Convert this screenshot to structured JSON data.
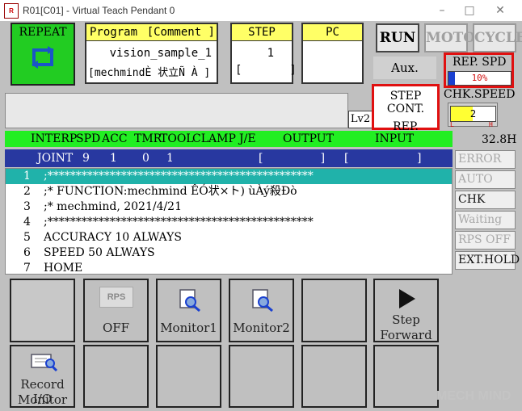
{
  "window": {
    "title": "R01[C01] - Virtual Teach Pendant 0",
    "icon": "robot-app-icon"
  },
  "mode_button": {
    "label": "REPEAT",
    "icon": "cycle-arrows-icon",
    "color": "#22cc22"
  },
  "program_panel": {
    "header_program": "Program",
    "header_comment": "[Comment ]",
    "program_name": "vision_sample_1",
    "comment_value": "[mechmindÈ 状立Ñ À ]"
  },
  "step_panel": {
    "header": "STEP",
    "value": "1",
    "bracket": "[       ]"
  },
  "pc_panel": {
    "header": "PC"
  },
  "mode_buttons": {
    "run": "RUN",
    "motor": "MOTOR",
    "cycle": "CYCLE"
  },
  "aux_label": "Aux.",
  "rep_spd": {
    "label": "REP. SPD",
    "value": "10%",
    "fill_percent": 10
  },
  "step_cont": {
    "line1": "STEP CONT.",
    "line2": "REP. ONCE"
  },
  "chk_speed": {
    "label": "CHK.SPEED",
    "value": "2",
    "l_label": "L",
    "h_label": "H"
  },
  "level_label": "Lv2",
  "status_header": {
    "interp": "INTERP",
    "spd": "SPD",
    "acc": "ACC",
    "tmr": "TMR",
    "tool": "TOOL",
    "clamp": "CLAMP",
    "je": "J/E",
    "output": "OUTPUT",
    "input": "INPUT"
  },
  "status_row": {
    "interp": "JOINT",
    "spd": "9",
    "acc": "1",
    "tmr": "0",
    "tool": "1",
    "output": "[                ]",
    "input": "[                   ]"
  },
  "time_value": "32.8H",
  "program_lines": [
    {
      "num": "1",
      "text": ";***********************************************"
    },
    {
      "num": "2",
      "text": ";* FUNCTION:mechmind ÊÓ状×ト) ùÀý殺Ðò"
    },
    {
      "num": "3",
      "text": ";* mechmind, 2021/4/21"
    },
    {
      "num": "4",
      "text": ";***********************************************"
    },
    {
      "num": "5",
      "text": "ACCURACY 10 ALWAYS"
    },
    {
      "num": "6",
      "text": "SPEED 50 ALWAYS"
    },
    {
      "num": "7",
      "text": "HOME"
    }
  ],
  "side_buttons": [
    "ERROR",
    "AUTO",
    "CHK once",
    "Waiting",
    "RPS OFF",
    "EXT.HOLD"
  ],
  "function_keys": {
    "rps": {
      "icon_label": "RPS",
      "label": "OFF"
    },
    "monitor1": "Monitor1",
    "monitor2": "Monitor2",
    "step_forward_line1": "Step",
    "step_forward_line2": "Forward",
    "record_io_line1": "Record I/O",
    "record_io_line2": "Monitor"
  },
  "watermark": "MECH MIND"
}
